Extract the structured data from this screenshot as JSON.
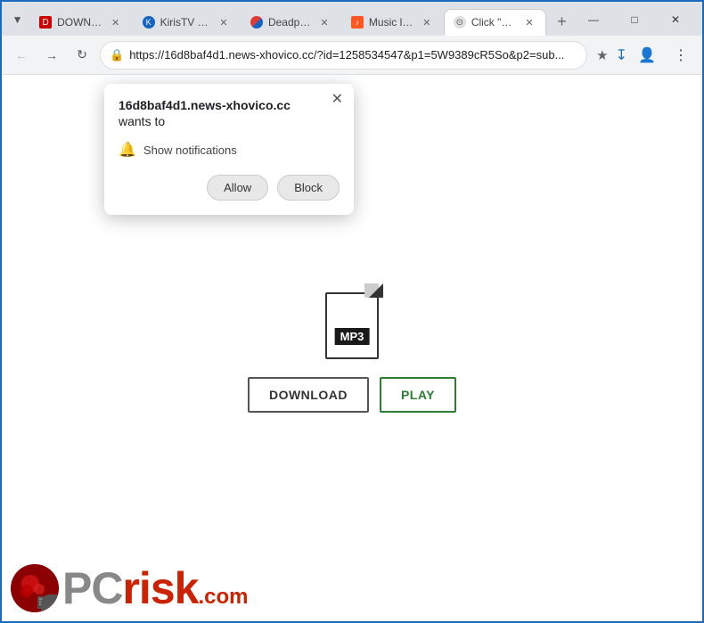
{
  "browser": {
    "tabs": [
      {
        "id": "tab1",
        "favicon_type": "fav-red",
        "favicon_label": "D",
        "title": "DOWNL...",
        "active": false
      },
      {
        "id": "tab2",
        "favicon_type": "fav-blue",
        "favicon_label": "K",
        "title": "KirisTV D...",
        "active": false
      },
      {
        "id": "tab3",
        "favicon_type": "fav-multi",
        "favicon_label": "",
        "title": "Deadpo...",
        "active": false
      },
      {
        "id": "tab4",
        "favicon_type": "fav-music",
        "favicon_label": "♪",
        "title": "Music la...",
        "active": false
      },
      {
        "id": "tab5",
        "favicon_type": "fav-click",
        "favicon_label": "⊙",
        "title": "Click \"Al...",
        "active": true
      }
    ],
    "address_bar": {
      "url": "https://16d8baf4d1.news-xhovico.cc/?id=1258534547&p1=5W9389cR5So&p2=sub...",
      "security_icon": "🔒"
    },
    "window_controls": {
      "minimize": "—",
      "maximize": "□",
      "close": "✕"
    }
  },
  "notification_popup": {
    "domain": "16d8baf4d1.news-xhovico.cc",
    "wants_to_text": "wants to",
    "permission_text": "Show notifications",
    "allow_label": "Allow",
    "block_label": "Block",
    "close_symbol": "✕"
  },
  "page": {
    "mp3_label": "MP3",
    "download_label": "DOWNLOAD",
    "play_label": "PLAY"
  },
  "pcrisk": {
    "text_pc": "PC",
    "text_risk": "risk",
    "dot_com": ".com"
  }
}
